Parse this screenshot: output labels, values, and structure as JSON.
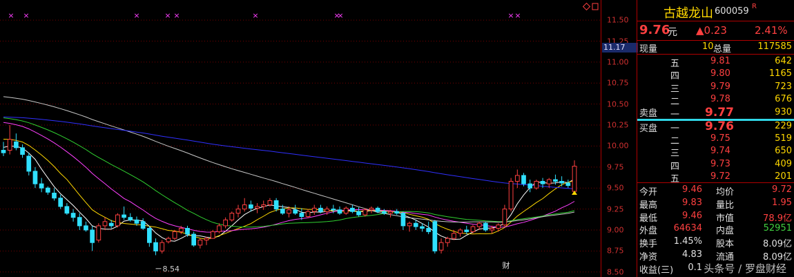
{
  "stock": {
    "name": "古越龙山",
    "code": "600059",
    "badge": "R"
  },
  "quote": {
    "price": "9.76",
    "unit": "元",
    "change": "▲0.23",
    "pct": "2.41%"
  },
  "volume_row": {
    "label1": "现量",
    "val1": "10",
    "label2": "总量",
    "val2": "117585"
  },
  "sell_label": "卖盘",
  "buy_label": "买盘",
  "sell": [
    {
      "lvl": "五",
      "price": "9.81",
      "vol": "642"
    },
    {
      "lvl": "四",
      "price": "9.80",
      "vol": "1165"
    },
    {
      "lvl": "三",
      "price": "9.79",
      "vol": "723"
    },
    {
      "lvl": "二",
      "price": "9.78",
      "vol": "676"
    },
    {
      "lvl": "一",
      "price": "9.77",
      "vol": "930"
    }
  ],
  "buy": [
    {
      "lvl": "一",
      "price": "9.76",
      "vol": "229"
    },
    {
      "lvl": "二",
      "price": "9.75",
      "vol": "519"
    },
    {
      "lvl": "三",
      "price": "9.74",
      "vol": "650"
    },
    {
      "lvl": "四",
      "price": "9.73",
      "vol": "409"
    },
    {
      "lvl": "五",
      "price": "9.72",
      "vol": "201"
    }
  ],
  "stats": [
    {
      "l1": "今开",
      "v1": "9.46",
      "l2": "均价",
      "v2": "9.72"
    },
    {
      "l1": "最高",
      "v1": "9.83",
      "l2": "量比",
      "v2": "1.95"
    },
    {
      "l1": "最低",
      "v1": "9.46",
      "l2": "市值",
      "v2": "78.9亿"
    },
    {
      "l1": "外盘",
      "v1": "64634",
      "l2": "内盘",
      "v2": "52951"
    },
    {
      "l1": "换手",
      "v1": "1.45%",
      "l2": "股本",
      "v2": "8.09亿"
    },
    {
      "l1": "净资",
      "v1": "4.83",
      "l2": "流通",
      "v2": "8.09亿"
    },
    {
      "l1": "收益(三)",
      "v1": "0.1",
      "l2": "",
      "v2": ""
    }
  ],
  "watermark": "头条号 / 罗盘财经",
  "chart_data": {
    "type": "candlestick",
    "y_ticks": [
      "11.50",
      "11.25",
      "11.00",
      "10.75",
      "10.50",
      "10.25",
      "10.00",
      "9.75",
      "9.50",
      "9.25",
      "9.00",
      "8.75",
      "8.50"
    ],
    "ylim": [
      8.44,
      11.74
    ],
    "current_price_label": "11.17",
    "low_annotation": "8.54",
    "markers": {
      "symbol": "×",
      "color": "#ff40ff"
    },
    "event_labels": [
      "财"
    ],
    "colors": {
      "up": "#ff4040",
      "down": "#30e0ff",
      "ma5": "#ffffff",
      "ma10": "#ffd800",
      "ma20": "#ff40ff",
      "ma30": "#30d030",
      "ma60": "#c8c8c8",
      "ma120": "#3030ff"
    },
    "candles": [
      [
        9.95,
        10.05,
        9.88,
        9.92
      ],
      [
        9.95,
        10.25,
        9.9,
        10.08
      ],
      [
        10.05,
        10.15,
        9.95,
        9.98
      ],
      [
        9.98,
        10.02,
        9.86,
        9.9
      ],
      [
        9.88,
        9.92,
        9.65,
        9.7
      ],
      [
        9.7,
        9.75,
        9.5,
        9.55
      ],
      [
        9.55,
        9.62,
        9.45,
        9.5
      ],
      [
        9.5,
        9.52,
        9.42,
        9.45
      ],
      [
        9.44,
        9.5,
        9.35,
        9.38
      ],
      [
        9.38,
        9.42,
        9.25,
        9.28
      ],
      [
        9.28,
        9.32,
        9.18,
        9.2
      ],
      [
        9.2,
        9.25,
        9.1,
        9.15
      ],
      [
        9.15,
        9.2,
        9.0,
        9.05
      ],
      [
        9.05,
        9.1,
        8.98,
        9.0
      ],
      [
        9.0,
        9.05,
        8.75,
        8.85
      ],
      [
        8.88,
        9.08,
        8.85,
        9.05
      ],
      [
        9.05,
        9.15,
        9.0,
        9.1
      ],
      [
        9.08,
        9.12,
        9.02,
        9.05
      ],
      [
        9.05,
        9.2,
        9.03,
        9.18
      ],
      [
        9.18,
        9.28,
        9.12,
        9.15
      ],
      [
        9.15,
        9.2,
        9.1,
        9.12
      ],
      [
        9.12,
        9.16,
        9.05,
        9.08
      ],
      [
        9.1,
        9.14,
        9.0,
        9.02
      ],
      [
        9.02,
        9.05,
        8.8,
        8.85
      ],
      [
        8.85,
        8.9,
        8.7,
        8.75
      ],
      [
        8.75,
        8.88,
        8.72,
        8.85
      ],
      [
        8.86,
        8.92,
        8.84,
        8.9
      ],
      [
        8.9,
        9.0,
        8.88,
        8.98
      ],
      [
        8.98,
        9.05,
        8.95,
        9.02
      ],
      [
        9.02,
        9.05,
        8.92,
        8.95
      ],
      [
        8.95,
        8.98,
        8.8,
        8.82
      ],
      [
        8.82,
        8.9,
        8.78,
        8.88
      ],
      [
        8.88,
        8.92,
        8.82,
        8.9
      ],
      [
        8.9,
        9.0,
        8.9,
        8.98
      ],
      [
        8.98,
        9.08,
        8.96,
        9.05
      ],
      [
        9.05,
        9.15,
        9.02,
        9.12
      ],
      [
        9.12,
        9.22,
        9.1,
        9.2
      ],
      [
        9.2,
        9.3,
        9.15,
        9.25
      ],
      [
        9.25,
        9.38,
        9.22,
        9.3
      ],
      [
        9.3,
        9.35,
        9.22,
        9.26
      ],
      [
        9.26,
        9.32,
        9.2,
        9.28
      ],
      [
        9.28,
        9.35,
        9.24,
        9.3
      ],
      [
        9.3,
        9.38,
        9.28,
        9.35
      ],
      [
        9.35,
        9.38,
        9.22,
        9.25
      ],
      [
        9.25,
        9.3,
        9.18,
        9.2
      ],
      [
        9.2,
        9.28,
        9.15,
        9.24
      ],
      [
        9.24,
        9.3,
        9.18,
        9.2
      ],
      [
        9.2,
        9.26,
        9.12,
        9.16
      ],
      [
        9.16,
        9.25,
        9.14,
        9.22
      ],
      [
        9.22,
        9.3,
        9.18,
        9.26
      ],
      [
        9.26,
        9.3,
        9.2,
        9.22
      ],
      [
        9.22,
        9.28,
        9.18,
        9.25
      ],
      [
        9.25,
        9.3,
        9.2,
        9.24
      ],
      [
        9.24,
        9.28,
        9.18,
        9.2
      ],
      [
        9.2,
        9.28,
        9.18,
        9.26
      ],
      [
        9.26,
        9.3,
        9.2,
        9.22
      ],
      [
        9.22,
        9.27,
        9.16,
        9.18
      ],
      [
        9.18,
        9.26,
        9.16,
        9.24
      ],
      [
        9.24,
        9.28,
        9.2,
        9.26
      ],
      [
        9.26,
        9.28,
        9.2,
        9.22
      ],
      [
        9.22,
        9.25,
        9.18,
        9.2
      ],
      [
        9.2,
        9.24,
        9.15,
        9.22
      ],
      [
        9.22,
        9.25,
        9.18,
        9.2
      ],
      [
        9.2,
        9.22,
        9.0,
        9.05
      ],
      [
        9.05,
        9.1,
        8.98,
        9.08
      ],
      [
        9.08,
        9.12,
        9.0,
        9.04
      ],
      [
        9.04,
        9.08,
        8.98,
        9.02
      ],
      [
        9.02,
        9.1,
        8.95,
        8.98
      ],
      [
        9.1,
        9.12,
        8.72,
        8.75
      ],
      [
        8.76,
        8.9,
        8.72,
        8.85
      ],
      [
        8.85,
        8.92,
        8.8,
        8.9
      ],
      [
        8.9,
        9.0,
        8.88,
        8.96
      ],
      [
        8.96,
        9.02,
        8.92,
        9.0
      ],
      [
        9.0,
        9.05,
        8.95,
        8.98
      ],
      [
        8.98,
        9.06,
        8.96,
        9.04
      ],
      [
        9.04,
        9.1,
        9.0,
        9.08
      ],
      [
        9.08,
        9.1,
        8.98,
        9.0
      ],
      [
        9.0,
        9.05,
        8.96,
        9.02
      ],
      [
        9.02,
        9.08,
        8.98,
        9.06
      ],
      [
        9.06,
        9.3,
        9.04,
        9.25
      ],
      [
        9.25,
        9.62,
        9.22,
        9.58
      ],
      [
        9.58,
        9.72,
        9.5,
        9.65
      ],
      [
        9.65,
        9.68,
        9.52,
        9.55
      ],
      [
        9.55,
        9.6,
        9.45,
        9.5
      ],
      [
        9.5,
        9.6,
        9.48,
        9.58
      ],
      [
        9.58,
        9.62,
        9.5,
        9.55
      ],
      [
        9.55,
        9.62,
        9.5,
        9.6
      ],
      [
        9.6,
        9.66,
        9.54,
        9.58
      ],
      [
        9.58,
        9.64,
        9.52,
        9.56
      ],
      [
        9.56,
        9.6,
        9.5,
        9.53
      ],
      [
        9.46,
        9.83,
        9.46,
        9.76
      ]
    ]
  }
}
